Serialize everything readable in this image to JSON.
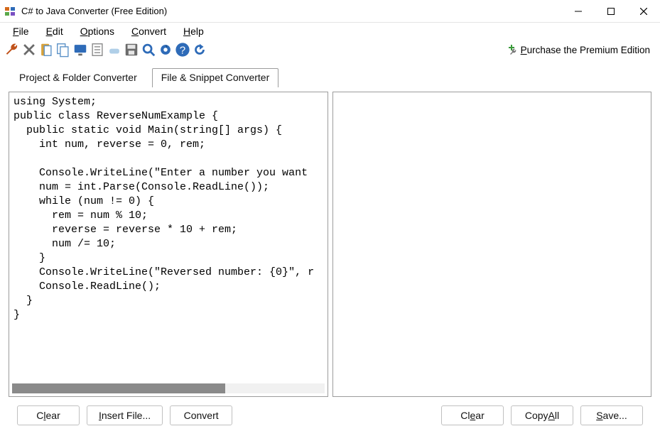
{
  "window": {
    "title": "C# to Java Converter (Free Edition)"
  },
  "menu": {
    "file": "File",
    "edit": "Edit",
    "options": "Options",
    "convert": "Convert",
    "help": "Help"
  },
  "toolbar": {
    "icons": [
      "wrench",
      "cut",
      "paste",
      "copy",
      "monitor",
      "sheet",
      "erase",
      "save",
      "search",
      "gear",
      "help",
      "refresh"
    ],
    "premium": "Purchase the Premium Edition"
  },
  "tabs": {
    "project": "Project & Folder Converter",
    "snippet": "File & Snippet Converter",
    "activeIndex": 1
  },
  "code_left": "using System;\npublic class ReverseNumExample {\n  public static void Main(string[] args) {\n    int num, reverse = 0, rem;\n\n    Console.WriteLine(\"Enter a number you want\n    num = int.Parse(Console.ReadLine());\n    while (num != 0) {\n      rem = num % 10;\n      reverse = reverse * 10 + rem;\n      num /= 10;\n    }\n    Console.WriteLine(\"Reversed number: {0}\", r\n    Console.ReadLine();\n  }\n}",
  "code_right": "",
  "buttons": {
    "clear_left": "Clear",
    "insert": "Insert File...",
    "convert": "Convert",
    "clear_right": "Clear",
    "copy_all": "Copy All",
    "save": "Save..."
  }
}
